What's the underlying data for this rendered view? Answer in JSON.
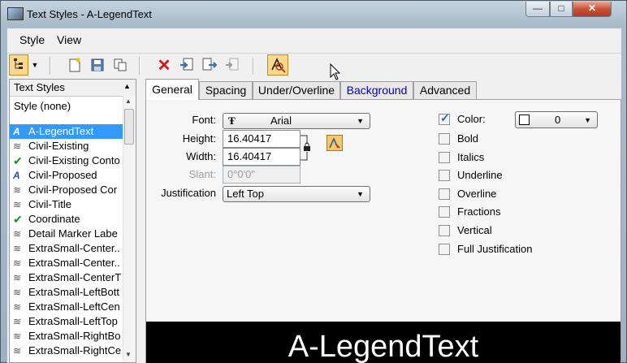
{
  "window": {
    "title": "Text Styles - A-LegendText",
    "min": "—",
    "max": "□",
    "close": "✕"
  },
  "menu": [
    {
      "label": "Style"
    },
    {
      "label": "View"
    }
  ],
  "left_panel": {
    "header": "Text Styles",
    "none_item": "Style (none)",
    "items": [
      {
        "label": "A-LegendText",
        "icon": "text-style-icon",
        "selected": true
      },
      {
        "label": "Civil-Existing",
        "icon": "layers-icon"
      },
      {
        "label": "Civil-Existing Conto",
        "icon": "checkmark-icon"
      },
      {
        "label": "Civil-Proposed",
        "icon": "text-style-icon"
      },
      {
        "label": "Civil-Proposed Cor",
        "icon": "layers-icon"
      },
      {
        "label": "Civil-Title",
        "icon": "layers-icon"
      },
      {
        "label": "Coordinate",
        "icon": "checkmark-icon"
      },
      {
        "label": "Detail Marker Labe",
        "icon": "layers-icon"
      },
      {
        "label": "ExtraSmall-Center..",
        "icon": "layers-icon"
      },
      {
        "label": "ExtraSmall-Center..",
        "icon": "layers-icon"
      },
      {
        "label": "ExtraSmall-CenterT",
        "icon": "layers-icon"
      },
      {
        "label": "ExtraSmall-LeftBott",
        "icon": "layers-icon"
      },
      {
        "label": "ExtraSmall-LeftCen",
        "icon": "layers-icon"
      },
      {
        "label": "ExtraSmall-LeftTop",
        "icon": "layers-icon"
      },
      {
        "label": "ExtraSmall-RightBo",
        "icon": "layers-icon"
      },
      {
        "label": "ExtraSmall-RightCe",
        "icon": "layers-icon"
      }
    ]
  },
  "tabs": [
    {
      "label": "General"
    },
    {
      "label": "Spacing"
    },
    {
      "label": "Under/Overline"
    },
    {
      "label": "Background"
    },
    {
      "label": "Advanced"
    }
  ],
  "general": {
    "font_label": "Font:",
    "font_value": "Arial",
    "height_label": "Height:",
    "height_value": "16.40417",
    "width_label": "Width:",
    "width_value": "16.40417",
    "slant_label": "Slant:",
    "slant_value": "0°0'0\"",
    "justification_label": "Justification",
    "justification_value": "Left Top",
    "color_label": "Color:",
    "color_value": "0",
    "checkboxes": [
      {
        "label": "Bold",
        "checked": false
      },
      {
        "label": "Italics",
        "checked": false
      },
      {
        "label": "Underline",
        "checked": false
      },
      {
        "label": "Overline",
        "checked": false
      },
      {
        "label": "Fractions",
        "checked": false
      },
      {
        "label": "Vertical",
        "checked": false
      },
      {
        "label": "Full Justification",
        "checked": false
      }
    ]
  },
  "preview": {
    "text": "A-LegendText",
    "background": "#000000",
    "color": "#ffffff"
  },
  "colors": {
    "selection": "#3399ff",
    "background_tab": "#0000cc",
    "active_tool": "#fbd98c"
  }
}
